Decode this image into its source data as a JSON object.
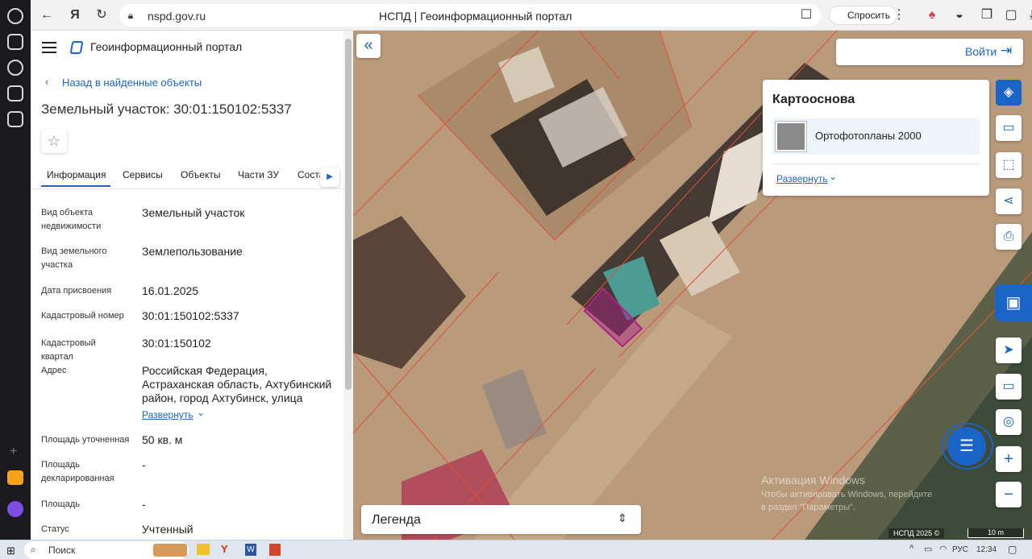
{
  "browser": {
    "url": "nspd.gov.ru",
    "tab_title": "НСПД | Геоинформационный портал",
    "ask_label": "Спросить"
  },
  "portal": {
    "title": "Геоинформационный портал",
    "back_link": "Назад в найденные объекты",
    "object_title": "Земельный участок: 30:01:150102:5337"
  },
  "tabs": [
    {
      "label": "Информация"
    },
    {
      "label": "Сервисы"
    },
    {
      "label": "Объекты"
    },
    {
      "label": "Части ЗУ"
    },
    {
      "label": "Соста"
    }
  ],
  "attributes": [
    {
      "label": "Вид объекта недвижимости",
      "value": "Земельный участок"
    },
    {
      "label": "Вид земельного участка",
      "value": "Землепользование"
    },
    {
      "label": "Дата присвоения",
      "value": "16.01.2025"
    },
    {
      "label": "Кадастровый номер",
      "value": "30:01:150102:5337"
    },
    {
      "label": "Кадастровый квартал",
      "value": "30:01:150102"
    },
    {
      "label": "Адрес",
      "value": "Российская Федерация, Астраханская область, Ахтубинский район, город Ахтубинск, улица"
    },
    {
      "label": "Площадь уточненная",
      "value": "50 кв. м"
    },
    {
      "label": "Площадь декларированная",
      "value": "-"
    },
    {
      "label": "Площадь",
      "value": "-"
    },
    {
      "label": "Статус",
      "value": "Учтенный"
    }
  ],
  "address_expand": "Развернуть",
  "map": {
    "login_label": "Войти",
    "basemap_title": "Картооснова",
    "basemap_item": "Ортофотопланы 2000",
    "basemap_expand": "Развернуть",
    "legend_label": "Легенда",
    "copyright": "НСПД 2025 ©",
    "scale_label": "10 m",
    "watermark_title": "Активация Windows",
    "watermark_text": "Чтобы активировать Windows, перейдите в раздел \"Параметры\"."
  },
  "taskbar": {
    "search_label": "Поиск",
    "lang": "РУС",
    "time": "12:34"
  },
  "colors": {
    "accent": "#1a64c8",
    "parcel_highlight": "#b0208a",
    "parcel_lines": "#e0503a"
  }
}
